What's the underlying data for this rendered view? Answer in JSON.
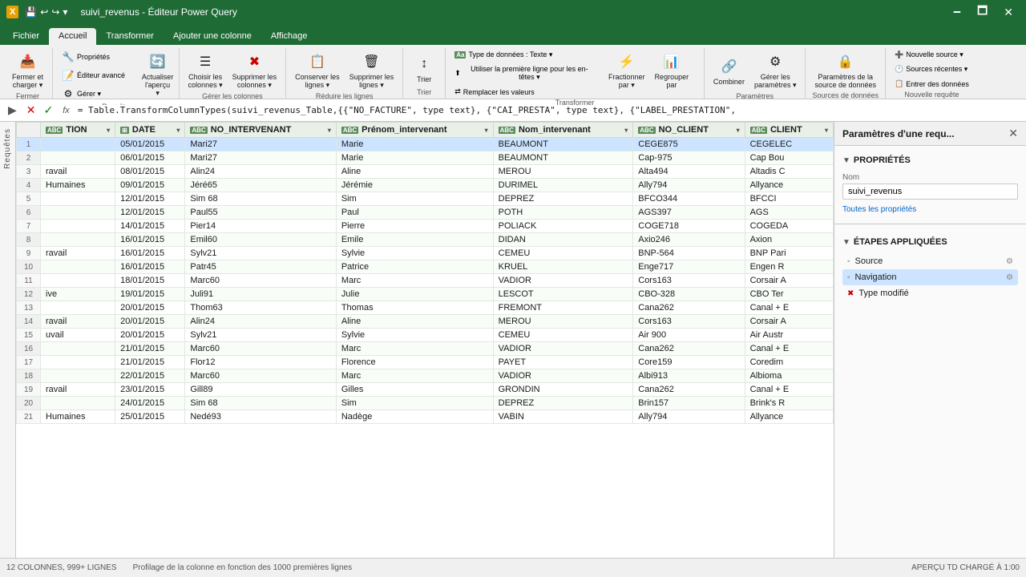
{
  "titleBar": {
    "logo": "X",
    "title": "suivi_revenus - Éditeur Power Query",
    "minBtn": "🗕",
    "maxBtn": "🗖",
    "closeBtn": "✕"
  },
  "ribbonTabs": [
    {
      "label": "Fichier",
      "active": false
    },
    {
      "label": "Accueil",
      "active": true
    },
    {
      "label": "Transformer",
      "active": false
    },
    {
      "label": "Ajouter une colonne",
      "active": false
    },
    {
      "label": "Affichage",
      "active": false
    }
  ],
  "ribbon": {
    "groups": [
      {
        "label": "Fermer",
        "buttons": [
          {
            "label": "Fermer et\ncharger ▾",
            "icon": "📥",
            "id": "close-load"
          }
        ]
      },
      {
        "label": "Requête",
        "buttons": [
          {
            "label": "Propriétés",
            "icon": "🔧",
            "id": "properties",
            "small": true
          },
          {
            "label": "Éditeur avancé",
            "icon": "📝",
            "id": "advanced-editor",
            "small": true
          },
          {
            "label": "Gérer ▾",
            "icon": "⚙",
            "id": "manage",
            "small": true
          },
          {
            "label": "Actualiser\nl'aperçu ▾",
            "icon": "🔄",
            "id": "refresh"
          }
        ]
      },
      {
        "label": "Gérer les colonnes",
        "buttons": [
          {
            "label": "Choisir les\ncolonnes ▾",
            "icon": "☰",
            "id": "choose-cols"
          },
          {
            "label": "Supprimer les\ncolonnes ▾",
            "icon": "✖",
            "id": "remove-cols"
          }
        ]
      },
      {
        "label": "Réduire les lignes",
        "buttons": [
          {
            "label": "Conserver les\nlignes ▾",
            "icon": "📋",
            "id": "keep-rows"
          },
          {
            "label": "Supprimer les\nlignes ▾",
            "icon": "🗑",
            "id": "remove-rows"
          }
        ]
      },
      {
        "label": "Trier",
        "buttons": [
          {
            "label": "Trier",
            "icon": "↕",
            "id": "sort"
          }
        ]
      },
      {
        "label": "Transformer",
        "buttons": [
          {
            "label": "Type de données : Texte ▾",
            "icon": "Aa",
            "id": "data-type",
            "small": true
          },
          {
            "label": "Utiliser la première ligne pour les en-têtes ▾",
            "icon": "⬆",
            "id": "first-row-header",
            "small": true
          },
          {
            "label": "Remplacer les valeurs",
            "icon": "⇄",
            "id": "replace-values",
            "small": true
          },
          {
            "label": "Fractionner\npar ▾",
            "icon": "⚡",
            "id": "split"
          },
          {
            "label": "Regrouper\npar",
            "icon": "📊",
            "id": "group-by"
          }
        ]
      },
      {
        "label": "Paramètres",
        "buttons": [
          {
            "label": "Combiner",
            "icon": "🔗",
            "id": "combine"
          },
          {
            "label": "Gérer les\nparamètres ▾",
            "icon": "⚙",
            "id": "manage-params"
          }
        ]
      },
      {
        "label": "Sources de données",
        "buttons": [
          {
            "label": "Paramètres de la\nsource de données",
            "icon": "🔒",
            "id": "source-params"
          }
        ]
      },
      {
        "label": "Nouvelle requête",
        "buttons": [
          {
            "label": "Nouvelle source ▾",
            "icon": "➕",
            "id": "new-source",
            "small": true
          },
          {
            "label": "Sources récentes ▾",
            "icon": "🕐",
            "id": "recent-sources",
            "small": true
          },
          {
            "label": "Entrer des données",
            "icon": "📋",
            "id": "enter-data",
            "small": true
          }
        ]
      }
    ]
  },
  "formulaBar": {
    "formula": "= Table.TransformColumnTypes(suivi_revenus_Table,{{\"NO_FACTURE\", type text}, {\"CAI_PRESTA\", type text}, {\"LABEL_PRESTATION\","
  },
  "sidebarToggle": {
    "label": "Requêtes"
  },
  "columns": [
    {
      "name": "TION",
      "type": "text"
    },
    {
      "name": "DATE",
      "type": "date"
    },
    {
      "name": "NO_INTERVENANT",
      "type": "text"
    },
    {
      "name": "Prénom_intervenant",
      "type": "text"
    },
    {
      "name": "Nom_intervenant",
      "type": "text"
    },
    {
      "name": "NO_CLIENT",
      "type": "text"
    },
    {
      "name": "CLIENT",
      "type": "text"
    }
  ],
  "rows": [
    {
      "num": 1,
      "tion": "",
      "date": "05/01/2015",
      "no_int": "Mari27",
      "prenom": "Marie",
      "nom": "BEAUMONT",
      "no_client": "CEGE875",
      "client": "CEGELEC"
    },
    {
      "num": 2,
      "tion": "",
      "date": "06/01/2015",
      "no_int": "Mari27",
      "prenom": "Marie",
      "nom": "BEAUMONT",
      "no_client": "Cap-975",
      "client": "Cap Bou"
    },
    {
      "num": 3,
      "tion": "ravail",
      "date": "08/01/2015",
      "no_int": "Alin24",
      "prenom": "Aline",
      "nom": "MEROU",
      "no_client": "Alta494",
      "client": "Altadis C"
    },
    {
      "num": 4,
      "tion": "Humaines",
      "date": "09/01/2015",
      "no_int": "Jéré65",
      "prenom": "Jérémie",
      "nom": "DURIMEL",
      "no_client": "Ally794",
      "client": "Allyance"
    },
    {
      "num": 5,
      "tion": "",
      "date": "12/01/2015",
      "no_int": "Sim 68",
      "prenom": "Sim",
      "nom": "DEPREZ",
      "no_client": "BFCO344",
      "client": "BFCCI"
    },
    {
      "num": 6,
      "tion": "",
      "date": "12/01/2015",
      "no_int": "Paul55",
      "prenom": "Paul",
      "nom": "POTH",
      "no_client": "AGS397",
      "client": "AGS"
    },
    {
      "num": 7,
      "tion": "",
      "date": "14/01/2015",
      "no_int": "Pier14",
      "prenom": "Pierre",
      "nom": "POLIACK",
      "no_client": "COGE718",
      "client": "COGEDA"
    },
    {
      "num": 8,
      "tion": "",
      "date": "16/01/2015",
      "no_int": "Emil60",
      "prenom": "Emile",
      "nom": "DIDAN",
      "no_client": "Axio246",
      "client": "Axion"
    },
    {
      "num": 9,
      "tion": "ravail",
      "date": "16/01/2015",
      "no_int": "Sylv21",
      "prenom": "Sylvie",
      "nom": "CEMEU",
      "no_client": "BNP-564",
      "client": "BNP Pari"
    },
    {
      "num": 10,
      "tion": "",
      "date": "16/01/2015",
      "no_int": "Patr45",
      "prenom": "Patrice",
      "nom": "KRUEL",
      "no_client": "Enge717",
      "client": "Engen R"
    },
    {
      "num": 11,
      "tion": "",
      "date": "18/01/2015",
      "no_int": "Marc60",
      "prenom": "Marc",
      "nom": "VADIOR",
      "no_client": "Cors163",
      "client": "Corsair A"
    },
    {
      "num": 12,
      "tion": "ive",
      "date": "19/01/2015",
      "no_int": "Juli91",
      "prenom": "Julie",
      "nom": "LESCOT",
      "no_client": "CBO-328",
      "client": "CBO Ter"
    },
    {
      "num": 13,
      "tion": "",
      "date": "20/01/2015",
      "no_int": "Thom63",
      "prenom": "Thomas",
      "nom": "FREMONT",
      "no_client": "Cana262",
      "client": "Canal + E"
    },
    {
      "num": 14,
      "tion": "ravail",
      "date": "20/01/2015",
      "no_int": "Alin24",
      "prenom": "Aline",
      "nom": "MEROU",
      "no_client": "Cors163",
      "client": "Corsair A"
    },
    {
      "num": 15,
      "tion": "uvail",
      "date": "20/01/2015",
      "no_int": "Sylv21",
      "prenom": "Sylvie",
      "nom": "CEMEU",
      "no_client": "Air 900",
      "client": "Air Austr"
    },
    {
      "num": 16,
      "tion": "",
      "date": "21/01/2015",
      "no_int": "Marc60",
      "prenom": "Marc",
      "nom": "VADIOR",
      "no_client": "Cana262",
      "client": "Canal + E"
    },
    {
      "num": 17,
      "tion": "",
      "date": "21/01/2015",
      "no_int": "Flor12",
      "prenom": "Florence",
      "nom": "PAYET",
      "no_client": "Core159",
      "client": "Coredim"
    },
    {
      "num": 18,
      "tion": "",
      "date": "22/01/2015",
      "no_int": "Marc60",
      "prenom": "Marc",
      "nom": "VADIOR",
      "no_client": "Albi913",
      "client": "Albioma"
    },
    {
      "num": 19,
      "tion": "ravail",
      "date": "23/01/2015",
      "no_int": "Gill89",
      "prenom": "Gilles",
      "nom": "GRONDIN",
      "no_client": "Cana262",
      "client": "Canal + E"
    },
    {
      "num": 20,
      "tion": "",
      "date": "24/01/2015",
      "no_int": "Sim 68",
      "prenom": "Sim",
      "nom": "DEPREZ",
      "no_client": "Brin157",
      "client": "Brink's R"
    },
    {
      "num": 21,
      "tion": "Humaines",
      "date": "25/01/2015",
      "no_int": "Nedé93",
      "prenom": "Nadège",
      "nom": "VABIN",
      "no_client": "Ally794",
      "client": "Allyance"
    }
  ],
  "rightPanel": {
    "title": "Paramètres d'une requ...",
    "properties": {
      "sectionLabel": "PROPRIÉTÉS",
      "nameLabel": "Nom",
      "nameValue": "suivi_revenus",
      "allPropsLink": "Toutes les propriétés"
    },
    "steps": {
      "sectionLabel": "ÉTAPES APPLIQUÉES",
      "items": [
        {
          "label": "Source",
          "hasGear": true,
          "error": false
        },
        {
          "label": "Navigation",
          "hasGear": true,
          "error": false
        },
        {
          "label": "Type modifié",
          "hasGear": false,
          "error": true
        }
      ]
    }
  },
  "statusBar": {
    "left": "12 COLONNES, 999+ LIGNES",
    "center": "Profilage de la colonne en fonction des 1000 premières lignes",
    "right": "APERÇU TD CHARGÉ À 1:00"
  }
}
